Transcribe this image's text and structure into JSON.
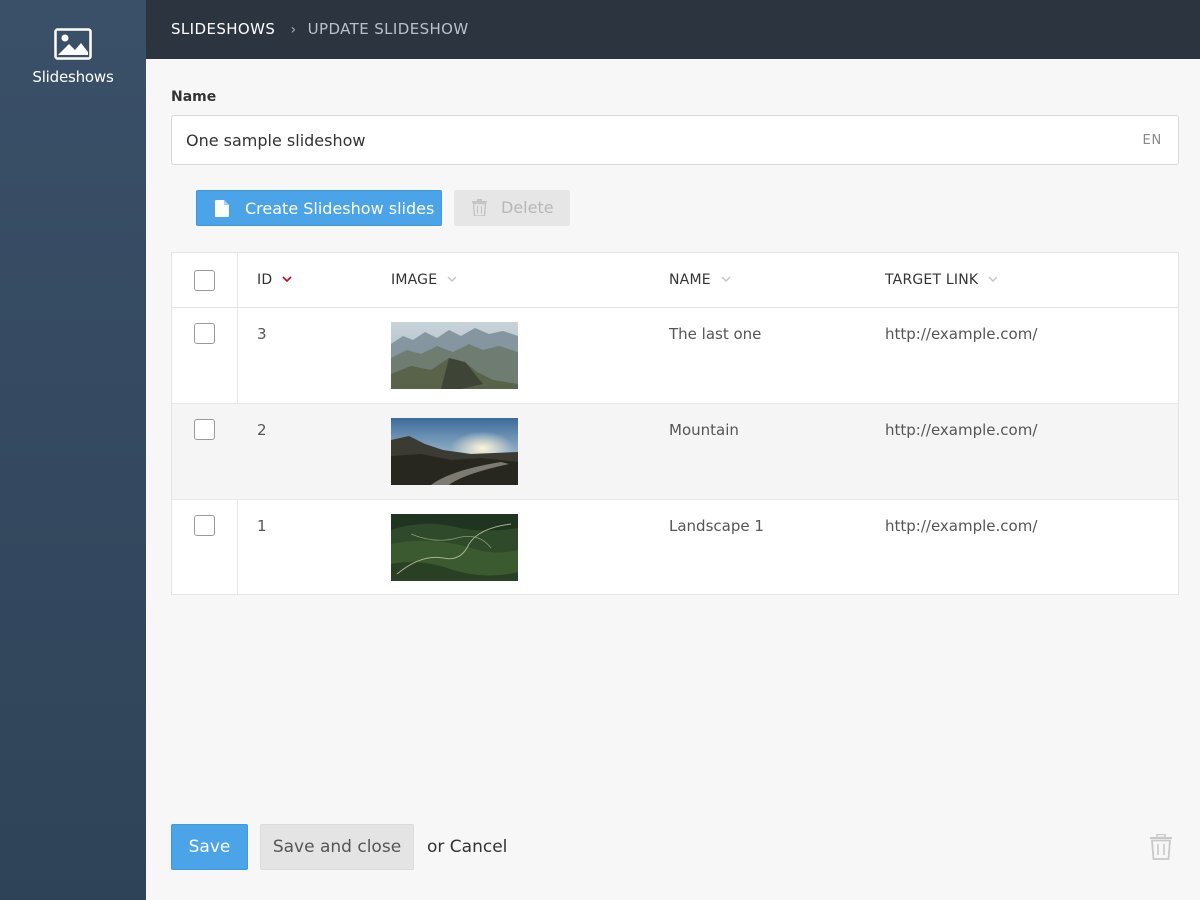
{
  "sidebar": {
    "items": [
      {
        "label": "Slideshows",
        "icon": "image-icon"
      }
    ]
  },
  "breadcrumb": {
    "items": [
      "SLIDESHOWS",
      "UPDATE SLIDESHOW"
    ],
    "separator_icon": "chevron-right-icon"
  },
  "form": {
    "name_label": "Name",
    "name_value": "One sample slideshow",
    "language": "EN"
  },
  "toolbar": {
    "create_label": "Create Slideshow slides",
    "create_icon": "document-icon",
    "delete_label": "Delete",
    "delete_icon": "trash-icon"
  },
  "table": {
    "columns": [
      "ID",
      "IMAGE",
      "NAME",
      "TARGET LINK"
    ],
    "sorted_column": "ID",
    "rows": [
      {
        "id": "3",
        "image": "mountain-ridge-thumbnail",
        "name": "The last one",
        "target_link": "http://example.com/"
      },
      {
        "id": "2",
        "image": "mountain-sunset-road-thumbnail",
        "name": "Mountain",
        "target_link": "http://example.com/"
      },
      {
        "id": "1",
        "image": "green-landscape-thumbnail",
        "name": "Landscape 1",
        "target_link": "http://example.com/"
      }
    ]
  },
  "footer": {
    "save_label": "Save",
    "save_close_label": "Save and close",
    "or_text": "or",
    "cancel_label": "Cancel",
    "delete_icon": "trash-icon"
  },
  "colors": {
    "sidebar": "#34495e",
    "header": "#2c3440",
    "primary": "#4ba3e8",
    "sort_indicator": "#d0021b"
  }
}
